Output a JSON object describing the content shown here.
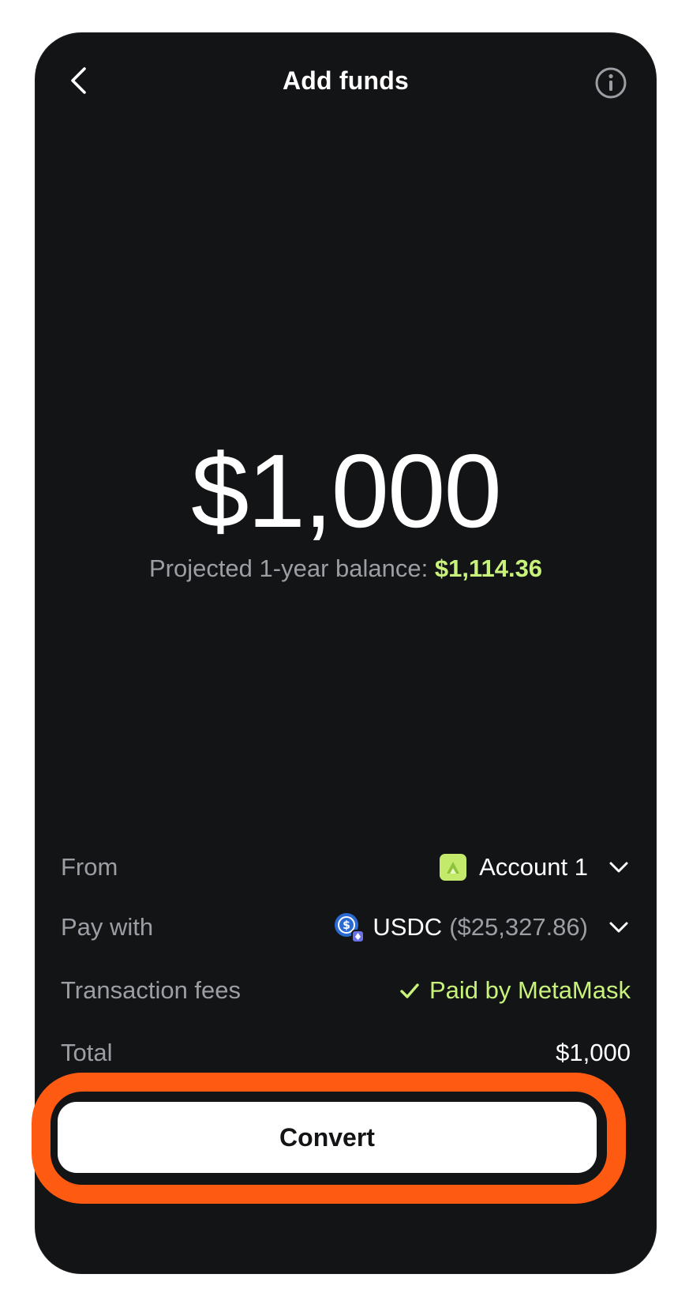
{
  "header": {
    "title": "Add funds",
    "back_icon": "chevron-left-icon",
    "info_icon": "info-icon"
  },
  "amount": {
    "value": "$1,000",
    "projected_label": "Projected 1-year balance:",
    "projected_value": "$1,114.36"
  },
  "details": {
    "from": {
      "label": "From",
      "value": "Account 1"
    },
    "pay_with": {
      "label": "Pay with",
      "token": "USDC",
      "balance": "($25,327.86)"
    },
    "fees": {
      "label": "Transaction fees",
      "value": "Paid by MetaMask"
    },
    "total": {
      "label": "Total",
      "value": "$1,000"
    }
  },
  "action": {
    "convert_label": "Convert"
  },
  "colors": {
    "background": "#131416",
    "accent_green": "#c9f27a",
    "highlight": "#ff5a12",
    "muted_text": "#9c9ea3"
  }
}
